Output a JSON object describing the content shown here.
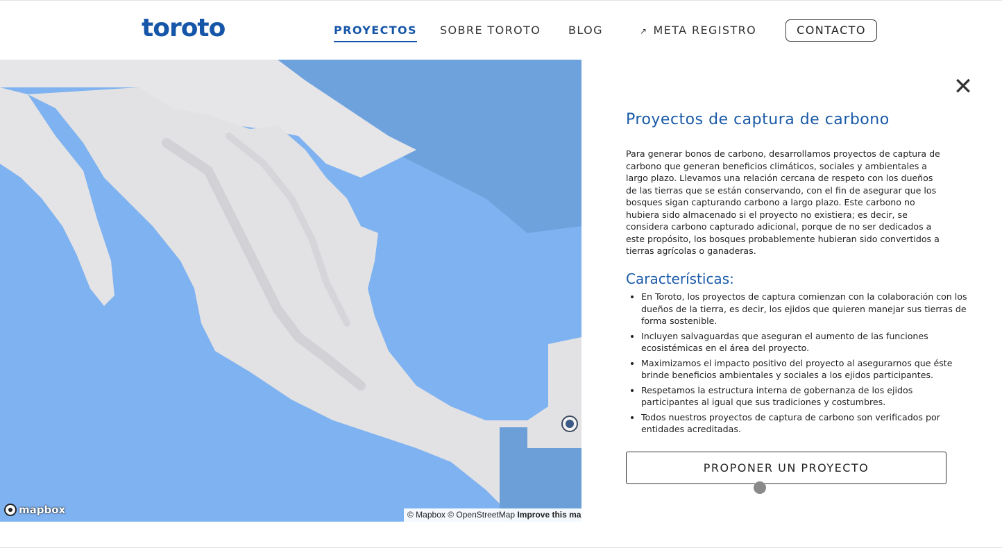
{
  "header": {
    "logo": "toroto",
    "nav": {
      "proyectos": "PROYECTOS",
      "sobre": "SOBRE TOROTO",
      "blog": "BLOG",
      "meta_icon": "external-link-icon",
      "meta": "META REGISTRO"
    },
    "contacto": "CONTACTO"
  },
  "map": {
    "logo_text": "mapbox",
    "attribution": {
      "mapbox": "© Mapbox",
      "osm": "© OpenStreetMap",
      "improve": "Improve this map"
    },
    "colors": {
      "water": "#7eb2f0",
      "water_dark": "#6c9fd8",
      "land": "#e4e4e6"
    }
  },
  "panel": {
    "close_icon": "close-icon",
    "title": "Proyectos de captura de carbono",
    "body": "Para generar bonos de carbono, desarrollamos proyectos de captura de carbono que generan beneficios climáticos, sociales y ambientales a largo plazo. Llevamos una relación cercana de respeto con los dueños de las tierras que se están conservando, con el fin de asegurar que los bosques sigan capturando carbono a largo plazo. Este carbono no hubiera sido almacenado si el proyecto no existiera; es decir, se considera carbono capturado adicional, porque de no ser dedicados a este propósito, los bosques probablemente hubieran sido convertidos a tierras agrícolas o ganaderas.",
    "features_title": "Características:",
    "features": [
      "En Toroto, los proyectos de captura comienzan con la colaboración con los dueños de la tierra, es decir, los ejidos que quieren manejar sus tierras de forma sostenible.",
      "Incluyen salvaguardas que aseguran el aumento de las funciones ecosistémicas en el área del proyecto.",
      "Maximizamos el impacto positivo del proyecto al asegurarnos que éste brinde beneficios ambientales y sociales a los ejidos participantes.",
      "Respetamos la estructura interna de gobernanza de los ejidos participantes al igual que sus tradiciones y costumbres.",
      "Todos nuestros proyectos de captura de carbono son verificados por entidades acreditadas."
    ],
    "button": "PROPONER UN PROYECTO"
  },
  "colors": {
    "brand": "#1656a8",
    "text": "#222222"
  }
}
